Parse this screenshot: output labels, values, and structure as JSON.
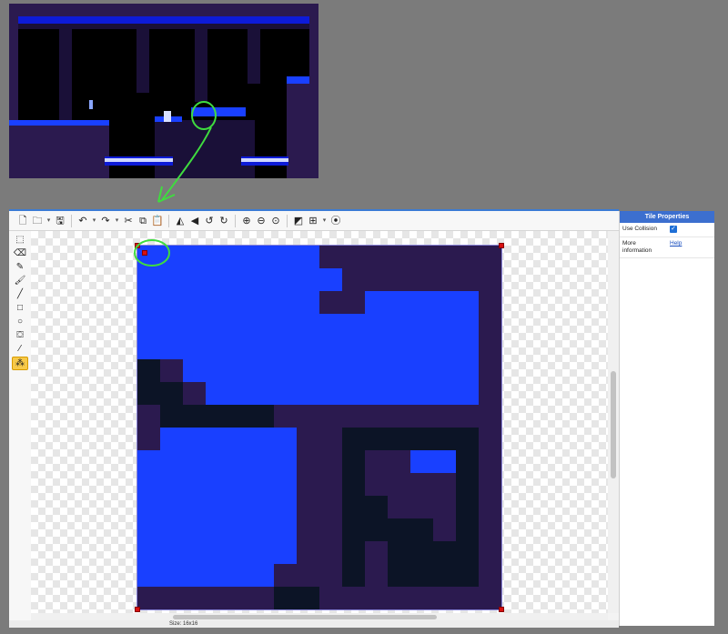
{
  "colors": {
    "blue": "#1940ff",
    "purple": "#2b1a4f",
    "dark": "#0c1426",
    "accent": "#3c6fcf",
    "annotation": "#3fdc3f"
  },
  "tile": {
    "legend": {
      "B": "blue",
      "P": "purple",
      "D": "dark"
    },
    "rows": [
      "BBBBBBBBPPPPPPPP",
      "BBBBBBBBBPPPPPPP",
      "BBBBBBBBPPBBBBBP",
      "BBBBBBBBBBBBBBBP",
      "BBBBBBBBBBBBBBBP",
      "DPBBBBBBBBBBBBBP",
      "DDPBBBBBBBBBBBBP",
      "PDDDDDPPPPPPPPPP",
      "PBBBBBBPPDDDDDDP",
      "BBBBBBBPPDPPBBDP",
      "BBBBBBBPPDPPPPDP",
      "BBBBBBBPPDDPPPDP",
      "BBBBBBBPPDDDDPDP",
      "BBBBBBBPPDPDDDDP",
      "BBBBBBPPPDPDDDDP",
      "PPPPPPDDPPPPPPPP"
    ]
  },
  "toolbar": {
    "icons": [
      "new-file-icon",
      "open-folder-icon",
      "chevron-down-icon",
      "save-icon",
      "undo-icon",
      "chevron-down-icon",
      "redo-icon",
      "chevron-down-icon",
      "cut-icon",
      "copy-icon",
      "paste-icon",
      "flip-horizontal-icon",
      "flip-vertical-icon",
      "rotate-left-icon",
      "rotate-right-icon",
      "zoom-in-icon",
      "zoom-out-icon",
      "zoom-reset-icon",
      "contrast-icon",
      "grid-icon",
      "chevron-down-icon",
      "play-icon"
    ]
  },
  "tools": [
    "selection-icon",
    "eraser-icon",
    "pencil-icon",
    "brush-icon",
    "line-icon",
    "rectangle-icon",
    "ellipse-icon",
    "fill-bucket-icon",
    "eyedropper-icon",
    "collision-tool-icon"
  ],
  "status": {
    "size": "Size: 16x16"
  },
  "props": {
    "title": "Tile Properties",
    "use_collision_label": "Use Collision",
    "more_info_label": "More information",
    "help_link": "Help"
  }
}
